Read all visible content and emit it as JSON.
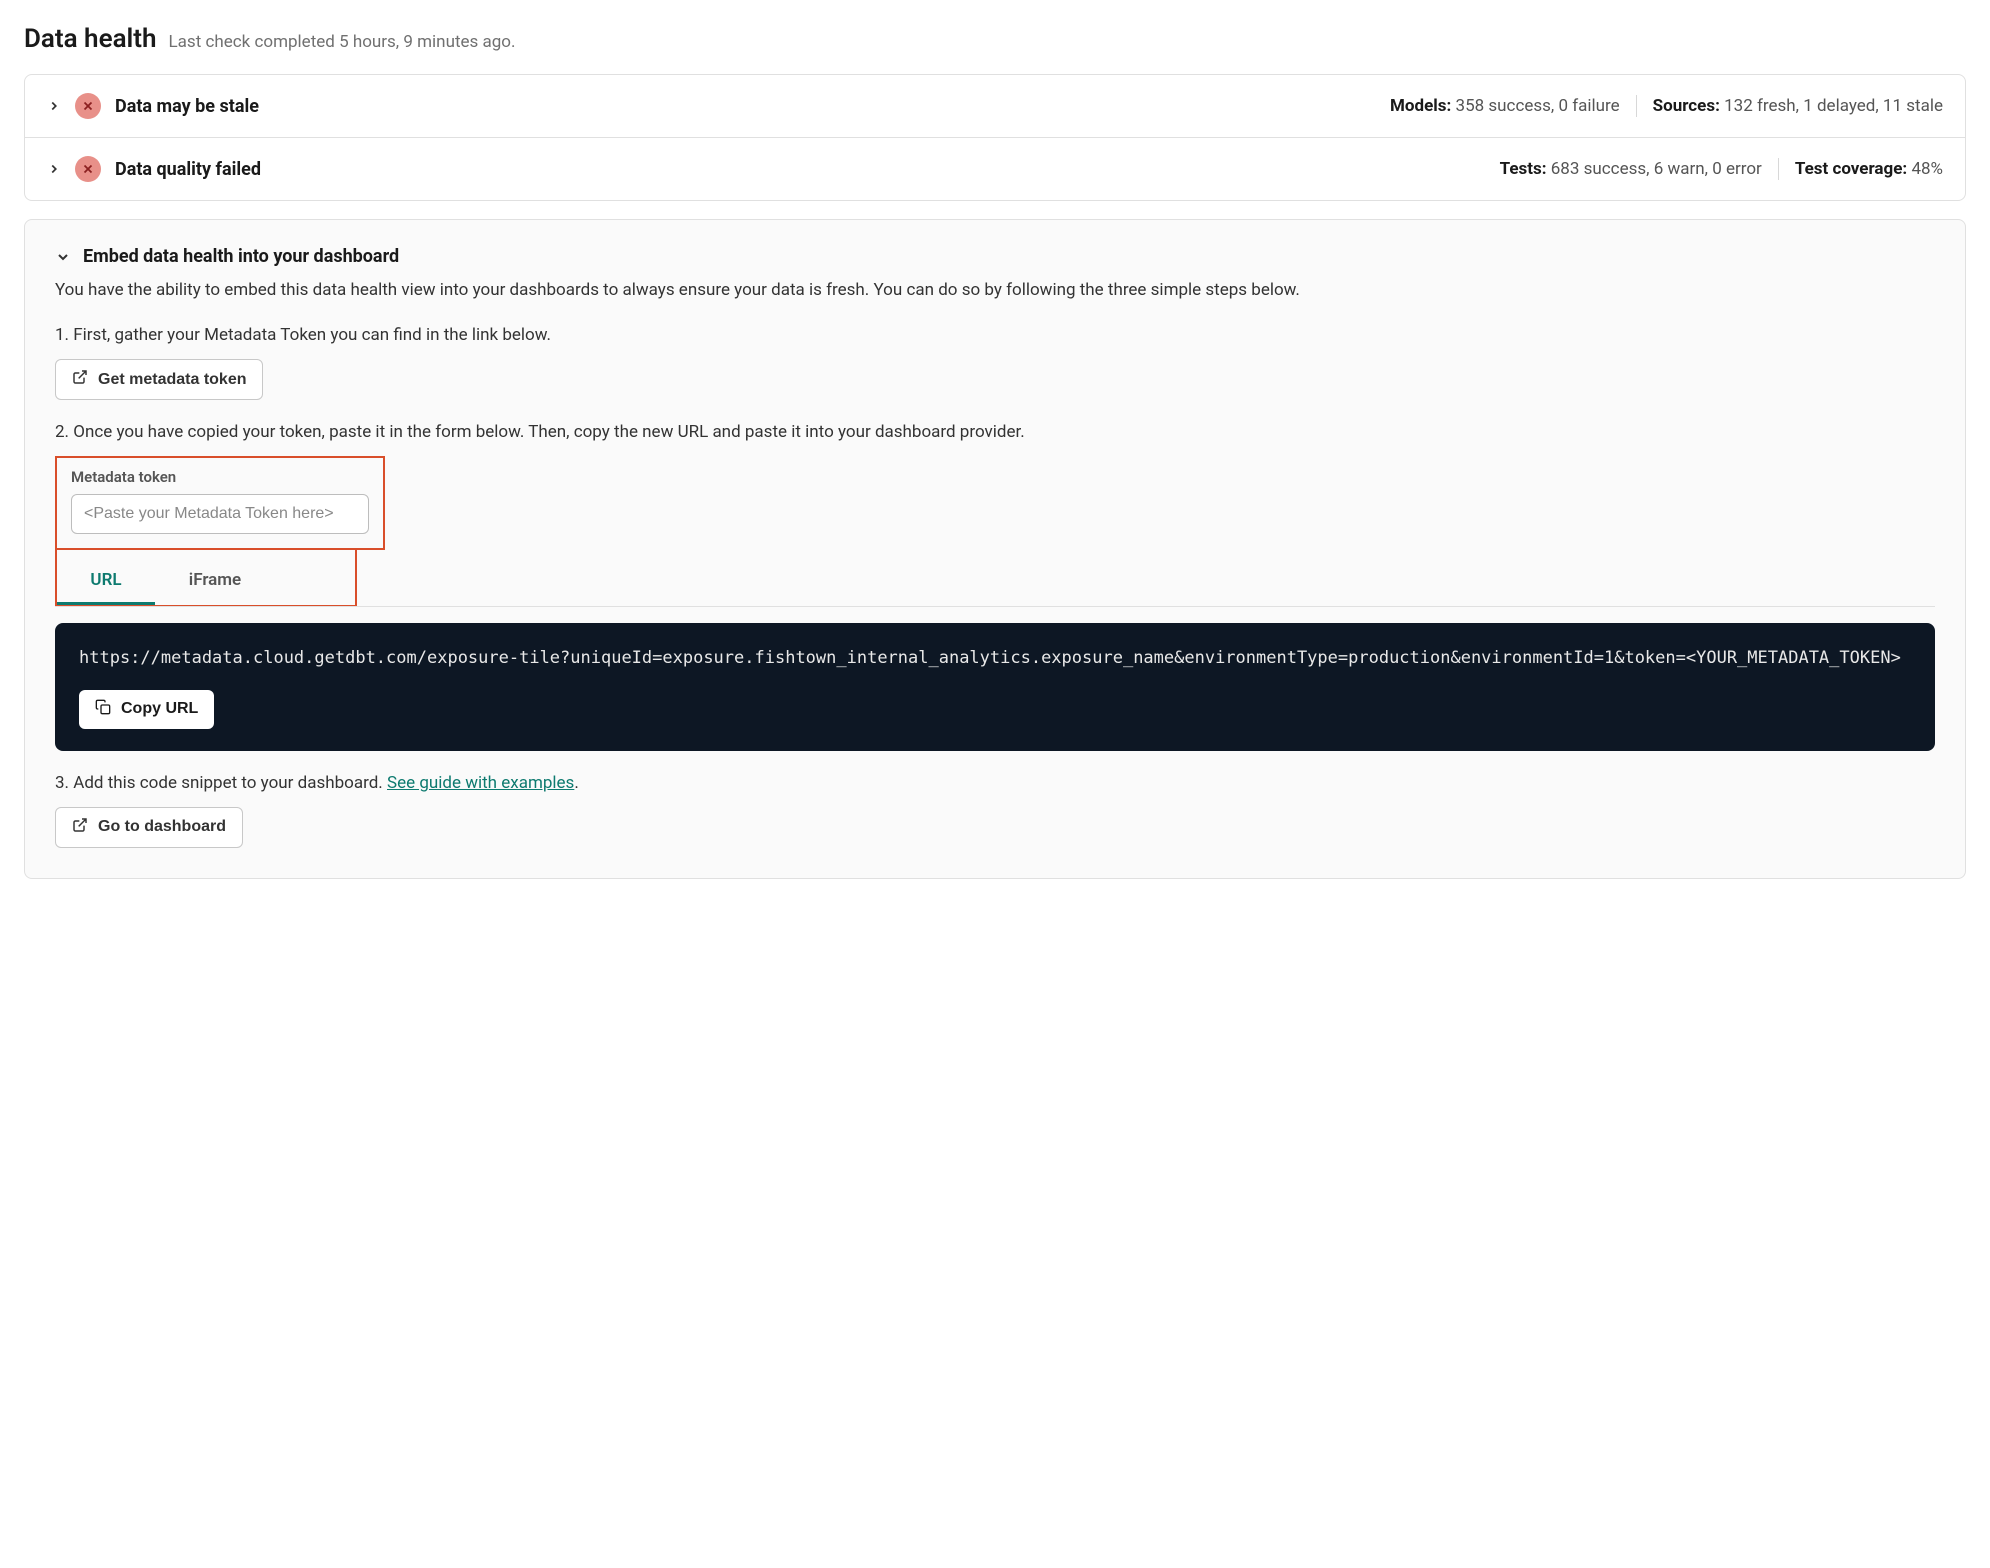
{
  "header": {
    "title": "Data health",
    "subtitle": "Last check completed 5 hours, 9 minutes ago."
  },
  "status": [
    {
      "title": "Data may be stale",
      "groups": [
        {
          "label": "Models:",
          "value": "358 success, 0 failure"
        },
        {
          "label": "Sources:",
          "value": "132 fresh, 1 delayed, 11 stale"
        }
      ]
    },
    {
      "title": "Data quality failed",
      "groups": [
        {
          "label": "Tests:",
          "value": "683 success, 6 warn, 0 error"
        },
        {
          "label": "Test coverage:",
          "value": "48%"
        }
      ]
    }
  ],
  "embed": {
    "title": "Embed data health into your dashboard",
    "desc": "You have the ability to embed this data health view into your dashboards to always ensure your data is fresh. You can do so by following the three simple steps below.",
    "step1": "1. First, gather your Metadata Token you can find in the link below.",
    "get_token_btn": "Get metadata token",
    "step2": "2. Once you have copied your token, paste it in the form below. Then, copy the new URL and paste it into your dashboard provider.",
    "token_label": "Metadata token",
    "token_placeholder": "<Paste your Metadata Token here>",
    "tabs": {
      "url": "URL",
      "iframe": "iFrame"
    },
    "code": "https://metadata.cloud.getdbt.com/exposure-tile?uniqueId=exposure.fishtown_internal_analytics.exposure_name&environmentType=production&environmentId=1&token=<YOUR_METADATA_TOKEN>",
    "copy_btn": "Copy URL",
    "step3_prefix": "3. Add this code snippet to your dashboard. ",
    "step3_link": "See guide with examples",
    "step3_suffix": ".",
    "dashboard_btn": "Go to dashboard"
  }
}
